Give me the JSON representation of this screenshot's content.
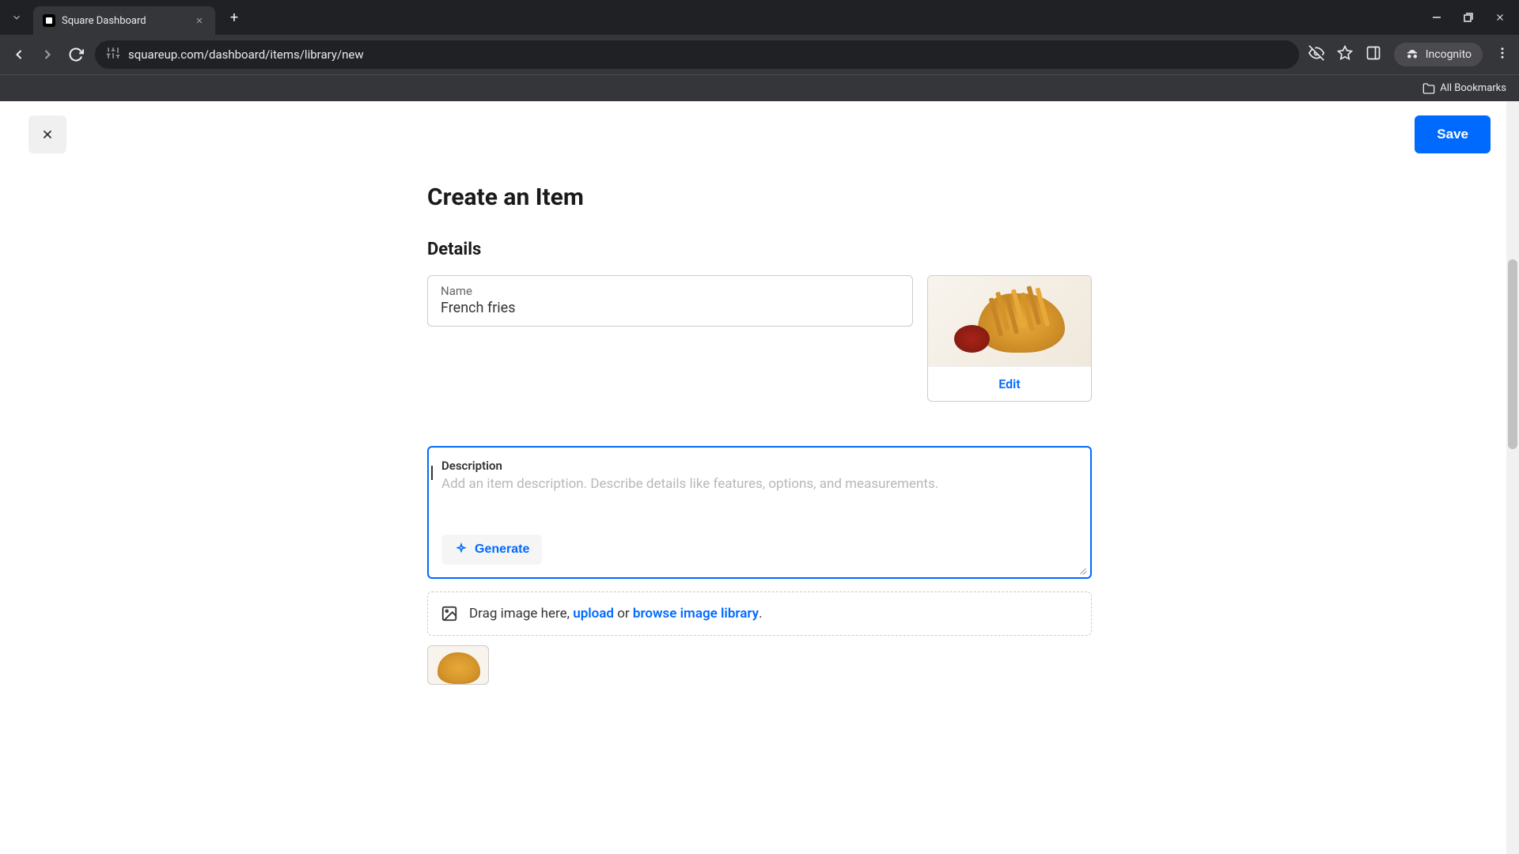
{
  "browser": {
    "tab_title": "Square Dashboard",
    "url": "squareup.com/dashboard/items/library/new",
    "incognito_label": "Incognito",
    "all_bookmarks": "All Bookmarks"
  },
  "header": {
    "save_label": "Save"
  },
  "page": {
    "title": "Create an Item",
    "details_heading": "Details",
    "name_label": "Name",
    "name_value": "French fries",
    "edit_label": "Edit",
    "description_label": "Description",
    "description_placeholder": "Add an item description. Describe details like features, options, and measurements.",
    "generate_label": "Generate",
    "dropzone_prefix": "Drag image here, ",
    "dropzone_upload": "upload",
    "dropzone_or": " or ",
    "dropzone_browse": "browse image library",
    "dropzone_suffix": "."
  }
}
